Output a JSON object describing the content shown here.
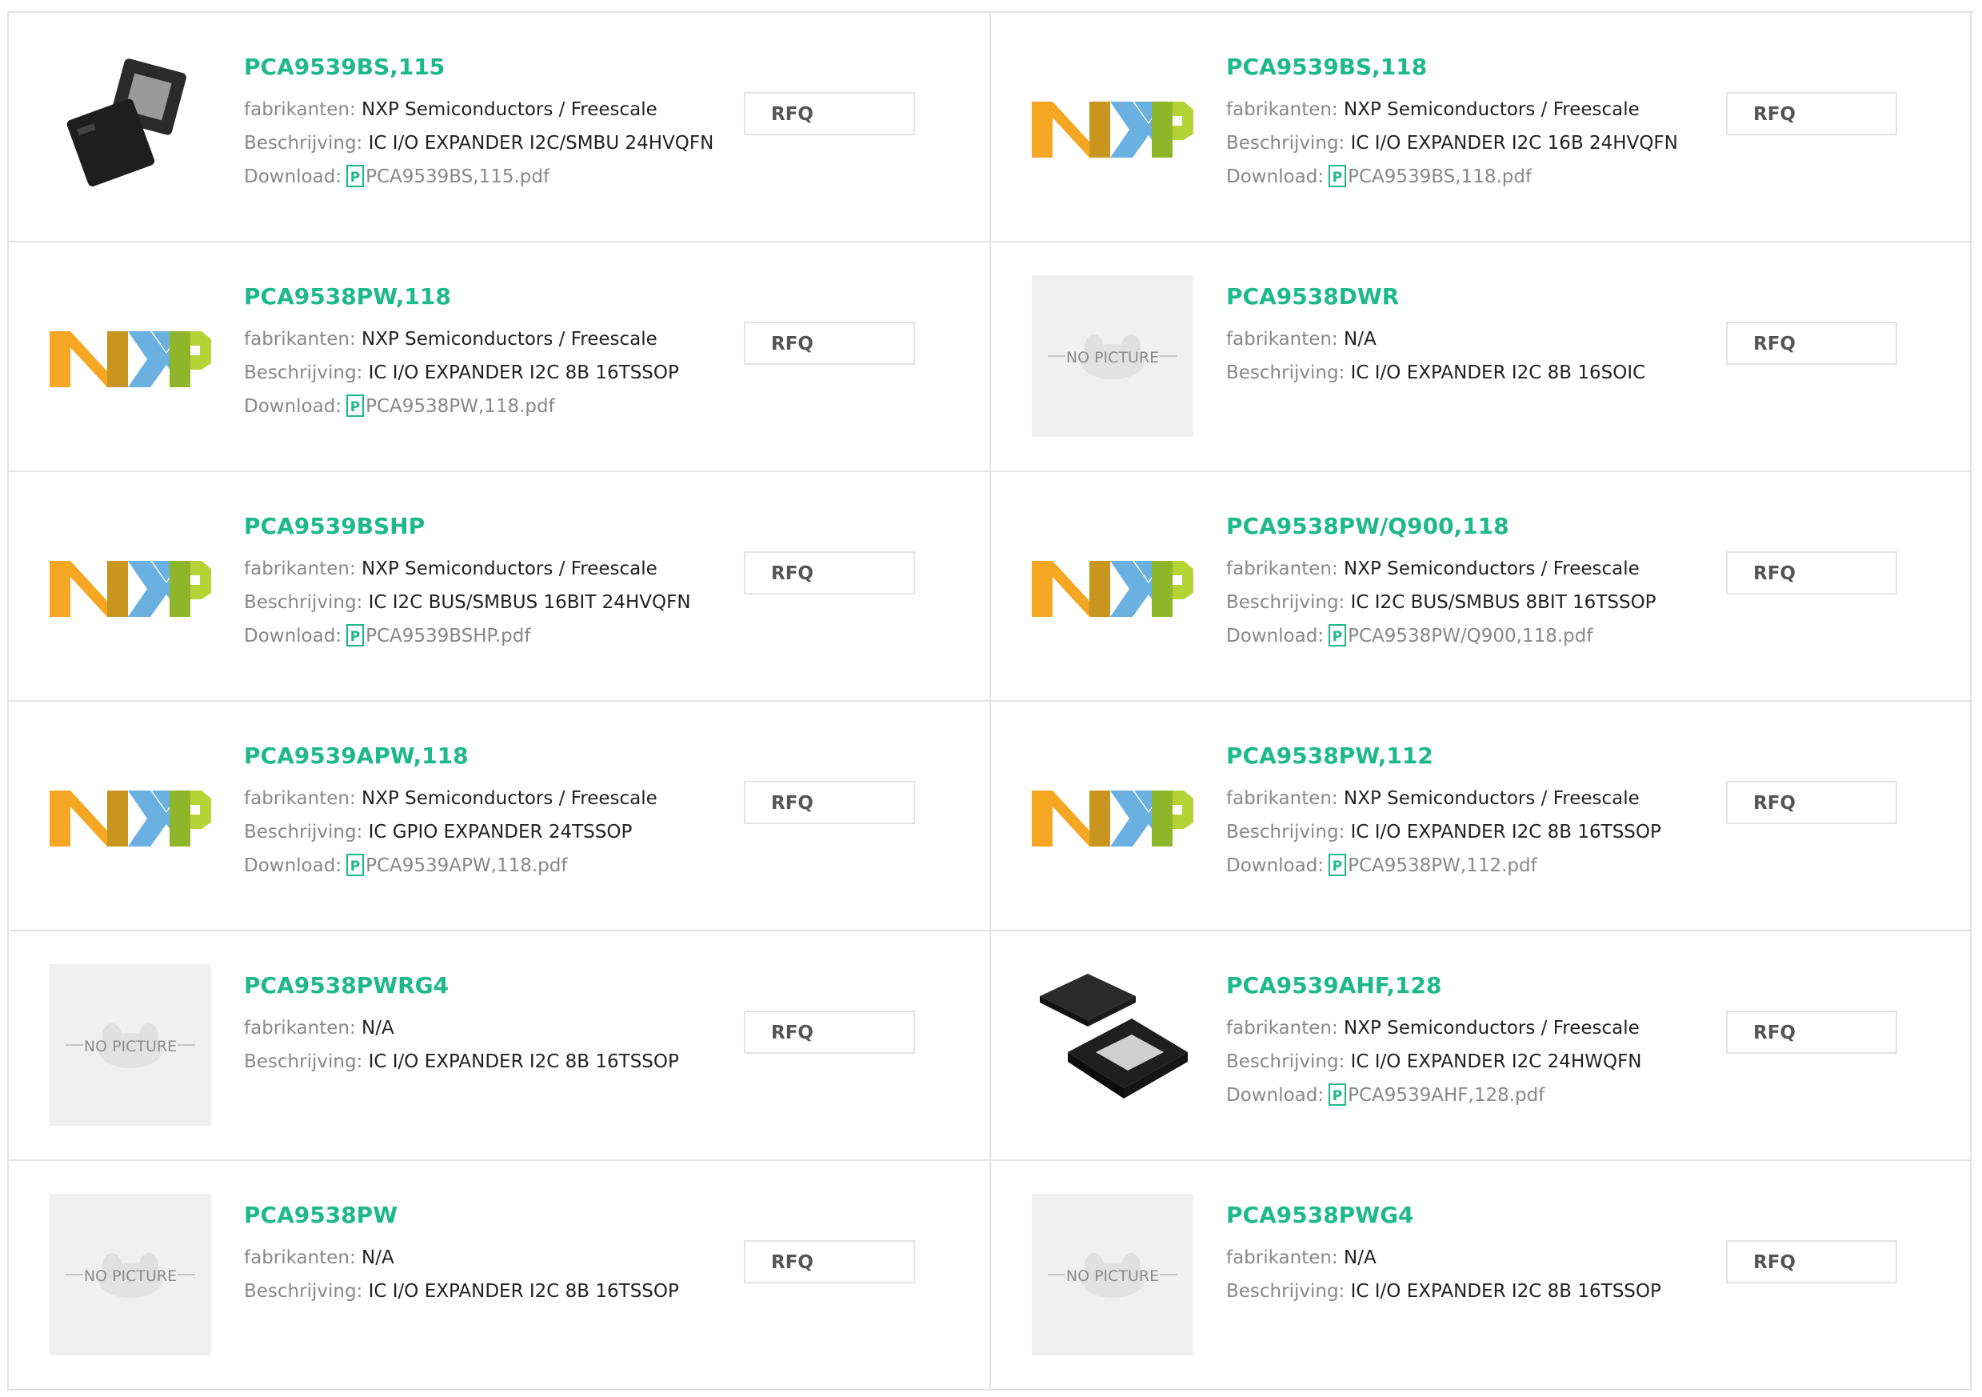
{
  "labels": {
    "manufacturer": "fabrikanten:",
    "description": "Beschrijving:",
    "download": "Download:",
    "rfq": "RFQ",
    "no_picture": "NO PICTURE"
  },
  "colors": {
    "accent": "#1eb98a",
    "border": "#e3e3e3",
    "nxp_orange": "#f5a623",
    "nxp_blue": "#6ab0e0",
    "nxp_green": "#b5d334"
  },
  "products": [
    {
      "name": "PCA9539BS,115",
      "manufacturer": "NXP Semiconductors / Freescale",
      "description": "IC I/O EXPANDER I2C/SMBU 24HVQFN",
      "pdf": "PCA9539BS,115.pdf",
      "image": "chip-qfn-icon"
    },
    {
      "name": "PCA9539BS,118",
      "manufacturer": "NXP Semiconductors / Freescale",
      "description": "IC I/O EXPANDER I2C 16B 24HVQFN",
      "pdf": "PCA9539BS,118.pdf",
      "image": "nxp-logo-icon"
    },
    {
      "name": "PCA9538PW,118",
      "manufacturer": "NXP Semiconductors / Freescale",
      "description": "IC I/O EXPANDER I2C 8B 16TSSOP",
      "pdf": "PCA9538PW,118.pdf",
      "image": "nxp-logo-icon"
    },
    {
      "name": "PCA9538DWR",
      "manufacturer": "N/A",
      "description": "IC I/O EXPANDER I2C 8B 16SOIC",
      "pdf": "",
      "image": "no-picture-icon"
    },
    {
      "name": "PCA9539BSHP",
      "manufacturer": "NXP Semiconductors / Freescale",
      "description": "IC I2C BUS/SMBUS 16BIT 24HVQFN",
      "pdf": "PCA9539BSHP.pdf",
      "image": "nxp-logo-icon"
    },
    {
      "name": "PCA9538PW/Q900,118",
      "manufacturer": "NXP Semiconductors / Freescale",
      "description": "IC I2C BUS/SMBUS 8BIT 16TSSOP",
      "pdf": "PCA9538PW/Q900,118.pdf",
      "image": "nxp-logo-icon"
    },
    {
      "name": "PCA9539APW,118",
      "manufacturer": "NXP Semiconductors / Freescale",
      "description": "IC GPIO EXPANDER 24TSSOP",
      "pdf": "PCA9539APW,118.pdf",
      "image": "nxp-logo-icon"
    },
    {
      "name": "PCA9538PW,112",
      "manufacturer": "NXP Semiconductors / Freescale",
      "description": "IC I/O EXPANDER I2C 8B 16TSSOP",
      "pdf": "PCA9538PW,112.pdf",
      "image": "nxp-logo-icon"
    },
    {
      "name": "PCA9538PWRG4",
      "manufacturer": "N/A",
      "description": "IC I/O EXPANDER I2C 8B 16TSSOP",
      "pdf": "",
      "image": "no-picture-icon"
    },
    {
      "name": "PCA9539AHF,128",
      "manufacturer": "NXP Semiconductors / Freescale",
      "description": "IC I/O EXPANDER I2C 24HWQFN",
      "pdf": "PCA9539AHF,128.pdf",
      "image": "chip-hwqfn-icon"
    },
    {
      "name": "PCA9538PW",
      "manufacturer": "N/A",
      "description": "IC I/O EXPANDER I2C 8B 16TSSOP",
      "pdf": "",
      "image": "no-picture-icon"
    },
    {
      "name": "PCA9538PWG4",
      "manufacturer": "N/A",
      "description": "IC I/O EXPANDER I2C 8B 16TSSOP",
      "pdf": "",
      "image": "no-picture-icon"
    }
  ]
}
